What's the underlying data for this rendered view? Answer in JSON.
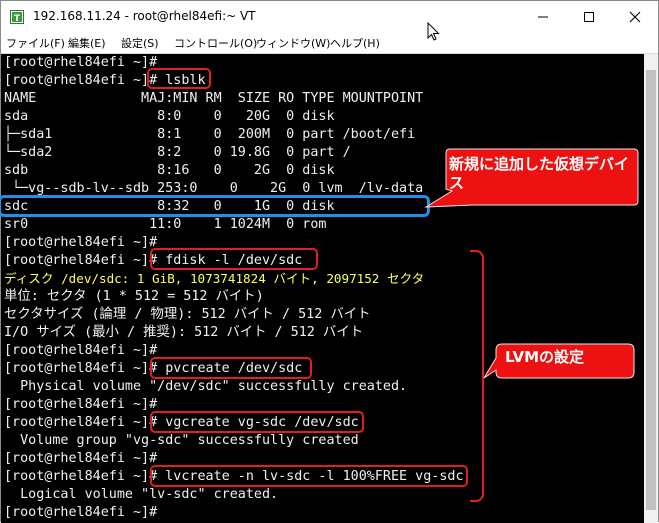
{
  "window": {
    "title": "192.168.11.24 - root@rhel84efi:~ VT"
  },
  "menu": [
    "ファイル(F)",
    "編集(E)",
    "設定(S)",
    "コントロール(O)",
    "ウィンドウ(W)",
    "ヘルプ(H)"
  ],
  "terminal": {
    "lines": [
      "[root@rhel84efi ~]#",
      "[root@rhel84efi ~]# lsblk",
      "NAME             MAJ:MIN RM  SIZE RO TYPE MOUNTPOINT",
      "sda                8:0    0   20G  0 disk",
      "├─sda1             8:1    0  200M  0 part /boot/efi",
      "└─sda2             8:2    0 19.8G  0 part /",
      "sdb                8:16   0    2G  0 disk",
      " └─vg--sdb-lv--sdb 253:0    0    2G  0 lvm  /lv-data",
      "sdc                8:32   0    1G  0 disk",
      "sr0               11:0    1 1024M  0 rom",
      "[root@rhel84efi ~]#",
      "[root@rhel84efi ~]# fdisk -l /dev/sdc",
      "ディスク /dev/sdc: 1 GiB, 1073741824 バイト, 2097152 セクタ",
      "単位: セクタ (1 * 512 = 512 バイト)",
      "セクタサイズ (論理 / 物理): 512 バイト / 512 バイト",
      "I/O サイズ (最小 / 推奨): 512 バイト / 512 バイト",
      "[root@rhel84efi ~]#",
      "[root@rhel84efi ~]# pvcreate /dev/sdc",
      "  Physical volume \"/dev/sdc\" successfully created.",
      "[root@rhel84efi ~]#",
      "[root@rhel84efi ~]# vgcreate vg-sdc /dev/sdc",
      "  Volume group \"vg-sdc\" successfully created",
      "[root@rhel84efi ~]#",
      "[root@rhel84efi ~]# lvcreate -n lv-sdc -l 100%FREE vg-sdc",
      "  Logical volume \"lv-sdc\" created.",
      "[root@rhel84efi ~]#"
    ]
  },
  "annotations": {
    "new_device": "新規に追加した仮想デバイス",
    "lvm_setup": "LVMの設定"
  },
  "colors": {
    "highlight_red": "#e02020",
    "highlight_blue": "#1e90e8",
    "callout_fill": "#ee1111",
    "yellow_text": "#ffff55"
  }
}
